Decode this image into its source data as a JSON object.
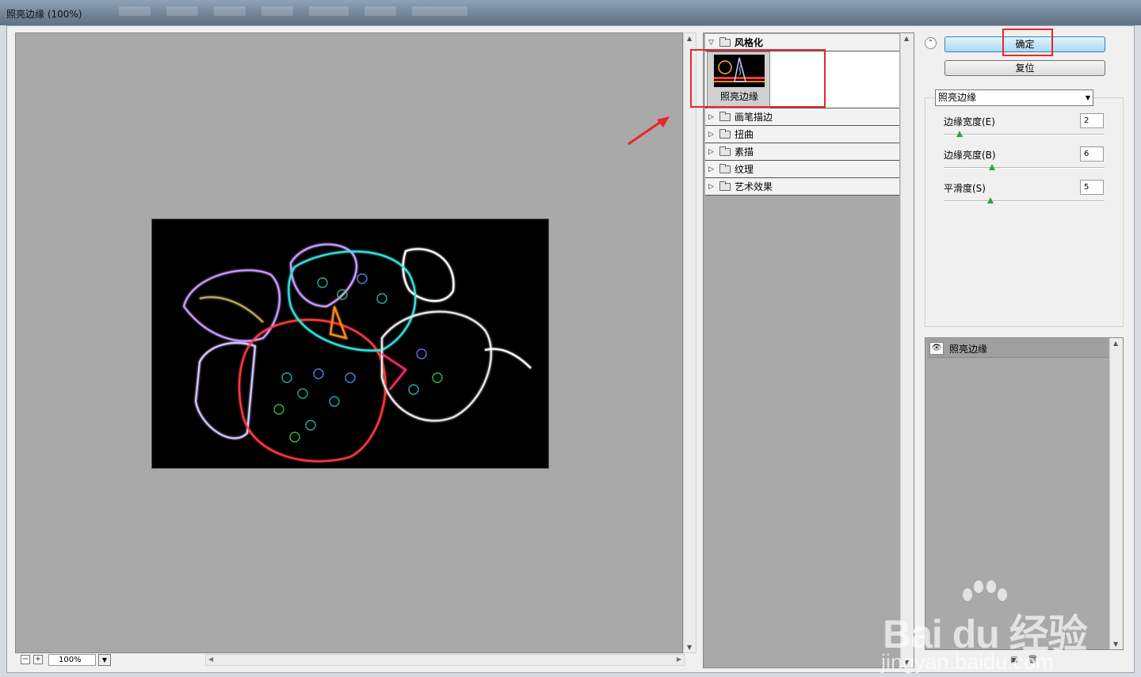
{
  "window": {
    "title": "照亮边缘 (100%)"
  },
  "preview": {
    "zoom_value": "100%",
    "zoom_out": "−",
    "zoom_in": "+"
  },
  "filter_gallery": {
    "open_category": {
      "label": "风格化",
      "thumbnail_label": "照亮边缘"
    },
    "categories": [
      {
        "label": "画笔描边"
      },
      {
        "label": "扭曲"
      },
      {
        "label": "素描"
      },
      {
        "label": "纹理"
      },
      {
        "label": "艺术效果"
      }
    ]
  },
  "buttons": {
    "ok": "确定",
    "reset": "复位"
  },
  "settings": {
    "filter_select": "照亮边缘",
    "params": [
      {
        "label": "边缘宽度(E)",
        "value": "2",
        "fraction": 0.1
      },
      {
        "label": "边缘亮度(B)",
        "value": "6",
        "fraction": 0.3
      },
      {
        "label": "平滑度(S)",
        "value": "5",
        "fraction": 0.29
      }
    ]
  },
  "layers": {
    "items": [
      {
        "label": "照亮边缘"
      }
    ]
  },
  "watermark": {
    "brand": "Bai du 经验",
    "url": "jingyan.baidu.com"
  },
  "colors": {
    "highlight": "#e8262c",
    "ok_button": "#a7d9f5",
    "slider_knob": "#2e9d4a",
    "panel_gray": "#a9a9a9"
  }
}
